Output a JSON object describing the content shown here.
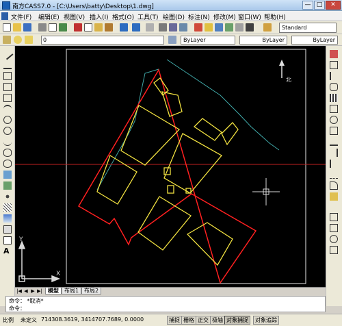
{
  "title_bar": {
    "title": "南方CASS7.0 - [C:\\Users\\batty\\Desktop\\1.dwg]",
    "minimize": "—",
    "maximize": "□",
    "close": "✕"
  },
  "menu": {
    "items": [
      "文件(F)",
      "编辑(E)",
      "视图(V)",
      "插入(I)",
      "格式(O)",
      "工具(T)",
      "绘图(D)",
      "标注(N)",
      "修改(M)",
      "窗口(W)",
      "帮助(H)"
    ]
  },
  "toolbar": {
    "text_style": "Standard",
    "layer": "0",
    "color": "ByLayer",
    "linetype": "ByLayer",
    "lineweight": "ByLayer"
  },
  "canvas": {
    "north_label": "北",
    "ucs_y": "Y",
    "ucs_x": "X",
    "colors": {
      "background": "#000000",
      "boundary": "#ff2020",
      "buildings": "#f0e040",
      "road": "#3fa7a7",
      "axis": "#c02020"
    }
  },
  "layout_tabs": [
    "模型",
    "布局1",
    "布局2"
  ],
  "command": {
    "line1": "命令： *取消*",
    "line2": "命令："
  },
  "status": {
    "scale_label": "比例",
    "scale_value": "未定义",
    "coords": "714308.3619, 3414707.7689, 0.0000",
    "buttons": [
      "捕捉",
      "栅格",
      "正交",
      "极轴",
      "对象捕捉",
      "对象追踪"
    ]
  }
}
